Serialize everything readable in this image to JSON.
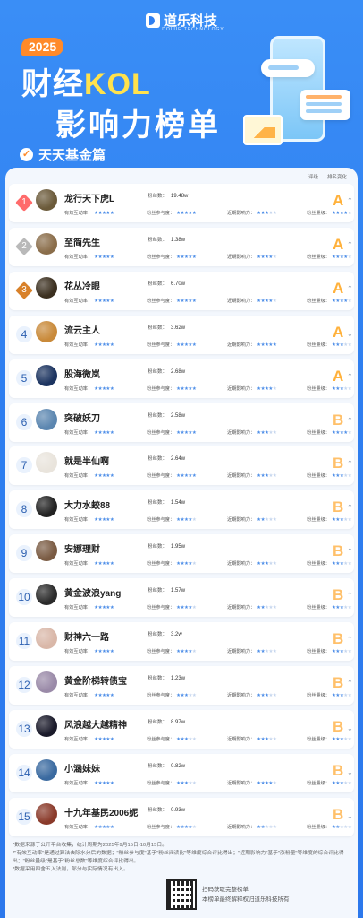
{
  "brand": {
    "name": "道乐科技",
    "sub": "DOLUE TECHNOLOGY"
  },
  "header": {
    "year": "2025",
    "title_pre": "财经",
    "title_kol": "KOL",
    "title2": "影响力榜单",
    "section": "天天基金篇"
  },
  "legend": {
    "grade": "评级",
    "trend": "排名变化"
  },
  "labels": {
    "fans": "粉丝数：",
    "m1": "有效互动率：",
    "m2": "粉丝参与度：",
    "m3": "近期影响力：",
    "m4": "粉丝量级："
  },
  "rows": [
    {
      "rank": "1",
      "name": "龙行天下虎L",
      "fans": "19.48w",
      "s": [
        5,
        5,
        3,
        4,
        5
      ],
      "grade": "A",
      "trend": "↑",
      "av": "#6b5a3a"
    },
    {
      "rank": "2",
      "name": "至简先生",
      "fans": "1.38w",
      "s": [
        5,
        5,
        4,
        4,
        3
      ],
      "grade": "A",
      "trend": "↑",
      "av": "#8a6d4a"
    },
    {
      "rank": "3",
      "name": "花丛冷眼",
      "fans": "6.70w",
      "s": [
        5,
        5,
        4,
        4,
        4
      ],
      "grade": "A",
      "trend": "↑",
      "av": "#3b2f1f"
    },
    {
      "rank": "4",
      "name": "流云主人",
      "fans": "3.62w",
      "s": [
        5,
        5,
        5,
        3,
        4
      ],
      "grade": "A",
      "trend": "↓",
      "av": "#c98a3a"
    },
    {
      "rank": "5",
      "name": "股海微岚",
      "fans": "2.68w",
      "s": [
        5,
        5,
        4,
        3,
        4
      ],
      "grade": "A",
      "trend": "↑",
      "av": "#1c3460"
    },
    {
      "rank": "6",
      "name": "突破妖刀",
      "fans": "2.58w",
      "s": [
        5,
        5,
        3,
        4,
        4
      ],
      "grade": "B",
      "trend": "↑",
      "av": "#5b86b0"
    },
    {
      "rank": "7",
      "name": "就是半仙啊",
      "fans": "2.64w",
      "s": [
        5,
        5,
        3,
        3,
        4
      ],
      "grade": "B",
      "trend": "↑",
      "av": "#e9e4dc"
    },
    {
      "rank": "8",
      "name": "大力水蛟88",
      "fans": "1.54w",
      "s": [
        5,
        4,
        2,
        3,
        3
      ],
      "grade": "B",
      "trend": "↑",
      "av": "#222222"
    },
    {
      "rank": "9",
      "name": "安娜理财",
      "fans": "1.95w",
      "s": [
        5,
        4,
        3,
        3,
        3
      ],
      "grade": "B",
      "trend": "↑",
      "av": "#7a5b43"
    },
    {
      "rank": "10",
      "name": "黄金波浪yang",
      "fans": "1.57w",
      "s": [
        5,
        4,
        2,
        3,
        3
      ],
      "grade": "B",
      "trend": "↑",
      "av": "#2a2a2a"
    },
    {
      "rank": "11",
      "name": "财神六一路",
      "fans": "3.2w",
      "s": [
        5,
        4,
        2,
        3,
        4
      ],
      "grade": "B",
      "trend": "↑",
      "av": "#d9b7a8"
    },
    {
      "rank": "12",
      "name": "黄金阶梯转债宝",
      "fans": "1.23w",
      "s": [
        5,
        3,
        3,
        3,
        3
      ],
      "grade": "B",
      "trend": "↑",
      "av": "#9a8aa8"
    },
    {
      "rank": "13",
      "name": "风浪越大越精神",
      "fans": "8.97w",
      "s": [
        5,
        3,
        3,
        3,
        4
      ],
      "grade": "B",
      "trend": "↓",
      "av": "#1a1a2a"
    },
    {
      "rank": "14",
      "name": "小涵妹妹",
      "fans": "0.82w",
      "s": [
        5,
        3,
        4,
        3,
        2
      ],
      "grade": "B",
      "trend": "↓",
      "av": "#3a6aa0"
    },
    {
      "rank": "15",
      "name": "十九年基民2006妮",
      "fans": "0.93w",
      "s": [
        5,
        4,
        2,
        2,
        2
      ],
      "grade": "B",
      "trend": "↓",
      "av": "#8a3a2a"
    }
  ],
  "notes": [
    "*数据来源于公开平台收集，统计周期为2025年9月15日-10月15日。",
    "*\"有效互动率\"是通过算法去除水分后的数据；\"粉丝参与度\"基于\"粉丝阅读比\"等维度综合评比得出；\"近期影响力\"基于\"涨粉量\"等维度的综合评比得出；\"粉丝量级\"是基于\"粉丝总数\"等维度综合评比得出。",
    "*数据采用四舍五入法则，部分与实际情况有出入。"
  ],
  "footer": {
    "line1": "扫码获取完整榜单",
    "line2": "本榜单最终解释权归道乐科技所有"
  }
}
